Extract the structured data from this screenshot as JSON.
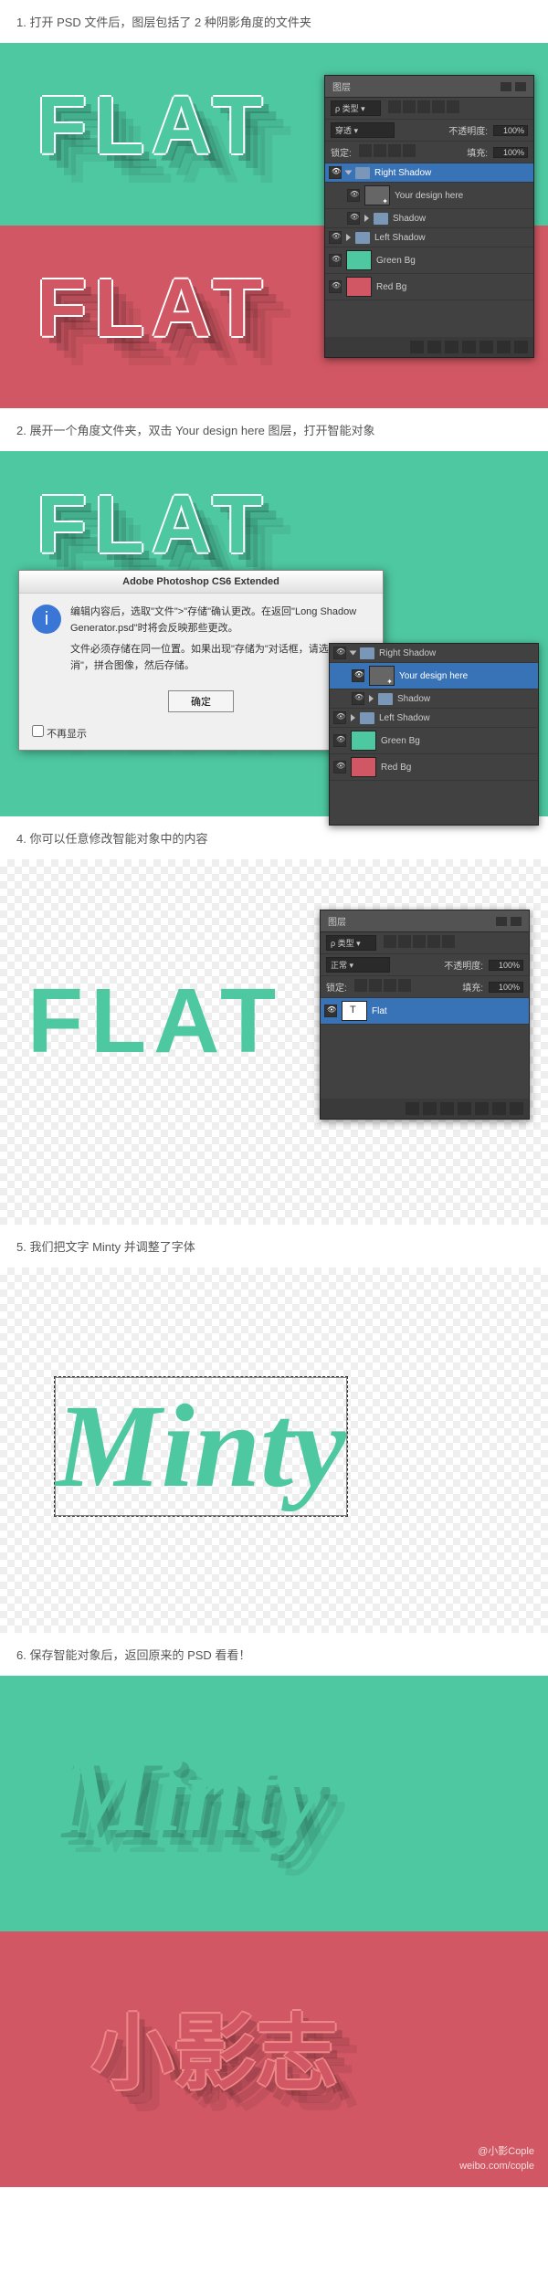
{
  "step1": "1. 打开 PSD 文件后，图层包括了 2 种阴影角度的文件夹",
  "step2": "2. 展开一个角度文件夹，双击 Your design here 图层，打开智能对象",
  "step4": "4. 你可以任意修改智能对象中的内容",
  "step5": "5. 我们把文字 Minty 并调整了字体",
  "step6": "6. 保存智能对象后，返回原来的 PSD 看看！",
  "flat_text": "FLAT",
  "minty_text": "Minty",
  "chinese_text": "小影志",
  "panel": {
    "title": "图层",
    "kind": "ρ 类型",
    "normal": "穿透",
    "normal2": "正常",
    "opacity_label": "不透明度:",
    "opacity": "100%",
    "lock_label": "锁定:",
    "fill_label": "填充:",
    "fill": "100%"
  },
  "layers1": [
    {
      "name": "Right Shadow",
      "type": "folder",
      "sel": true,
      "open": true
    },
    {
      "name": "Your design here",
      "type": "so",
      "indent": 1
    },
    {
      "name": "Shadow",
      "type": "folder",
      "indent": 1
    },
    {
      "name": "Left Shadow",
      "type": "folder"
    },
    {
      "name": "Green Bg",
      "type": "gr"
    },
    {
      "name": "Red Bg",
      "type": "rd"
    }
  ],
  "layers2": [
    {
      "name": "Right Shadow",
      "type": "folder",
      "open": true
    },
    {
      "name": "Your design here",
      "type": "so",
      "sel": true,
      "indent": 1
    },
    {
      "name": "Shadow",
      "type": "folder",
      "indent": 1
    },
    {
      "name": "Left Shadow",
      "type": "folder"
    },
    {
      "name": "Green Bg",
      "type": "gr"
    },
    {
      "name": "Red Bg",
      "type": "rd"
    }
  ],
  "layers3": [
    {
      "name": "Flat",
      "type": "flat",
      "sel": true
    }
  ],
  "dialog": {
    "title": "Adobe Photoshop CS6 Extended",
    "line1": "编辑内容后，选取\"文件\">\"存储\"确认更改。在返回\"Long Shadow Generator.psd\"时将会反映那些更改。",
    "line2": "文件必须存储在同一位置。如果出现\"存储为\"对话框，请选择\"取消\"，拼合图像，然后存储。",
    "ok": "确定",
    "dontshow": "不再显示"
  },
  "watermark": {
    "line1": "@小影Cople",
    "line2": "weibo.com/cople"
  }
}
